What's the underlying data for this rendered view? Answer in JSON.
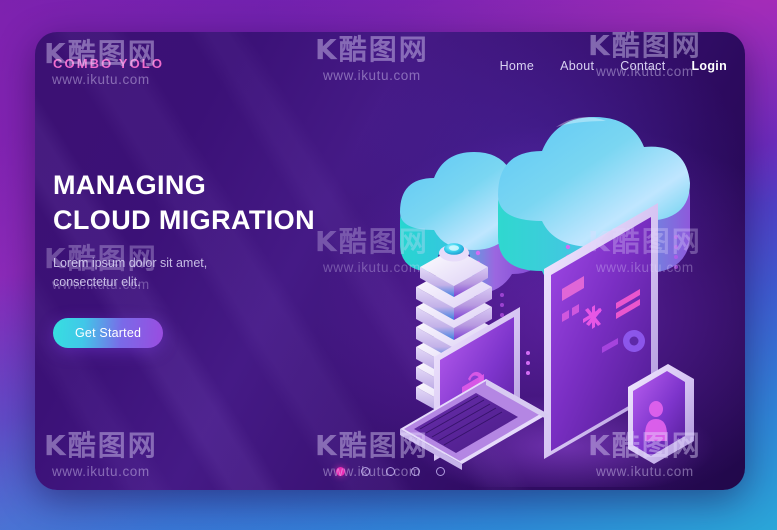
{
  "header": {
    "brand": "COMBO YOLO",
    "nav": [
      {
        "label": "Home",
        "name": "nav-link-home"
      },
      {
        "label": "About",
        "name": "nav-link-about"
      },
      {
        "label": "Contact",
        "name": "nav-link-contact"
      },
      {
        "label": "Login",
        "name": "nav-link-login"
      }
    ]
  },
  "hero": {
    "headline_line1": "MANAGING",
    "headline_line2": "CLOUD MIGRATION",
    "subhead_line1": "Lorem ipsum dolor sit amet,",
    "subhead_line2": "consectetur elit.",
    "cta_label": "Get Started"
  },
  "illustration": {
    "alt": "isometric cloud migration illustration",
    "elements": [
      {
        "name": "cloud-large",
        "type": "cloud"
      },
      {
        "name": "cloud-small",
        "type": "cloud"
      },
      {
        "name": "server-stack",
        "type": "server",
        "layers": 7
      },
      {
        "name": "laptop",
        "type": "device",
        "screen_icon": "lock-icon"
      },
      {
        "name": "monitor",
        "type": "device",
        "screen_icons": [
          "chat-icon",
          "chart-icon",
          "asterisk-icon",
          "sliders-icon",
          "gear-icon"
        ]
      },
      {
        "name": "smartphone",
        "type": "device",
        "screen_icon": "user-icon"
      }
    ]
  },
  "pager": {
    "dots": [
      {
        "active": true
      },
      {
        "active": false
      },
      {
        "active": false
      },
      {
        "active": false
      },
      {
        "active": false
      }
    ]
  },
  "watermark": {
    "logo": "K酷图网",
    "url": "www.ikutu.com"
  },
  "colors": {
    "accent_pink": "#e82cb4",
    "brand_pink": "#f06ccd",
    "cta_cyan": "#36e0e0",
    "cta_purple": "#9a4ce0",
    "card_purple": "#3c1173",
    "text_light": "#ffffff",
    "text_muted": "#c6bce4"
  }
}
